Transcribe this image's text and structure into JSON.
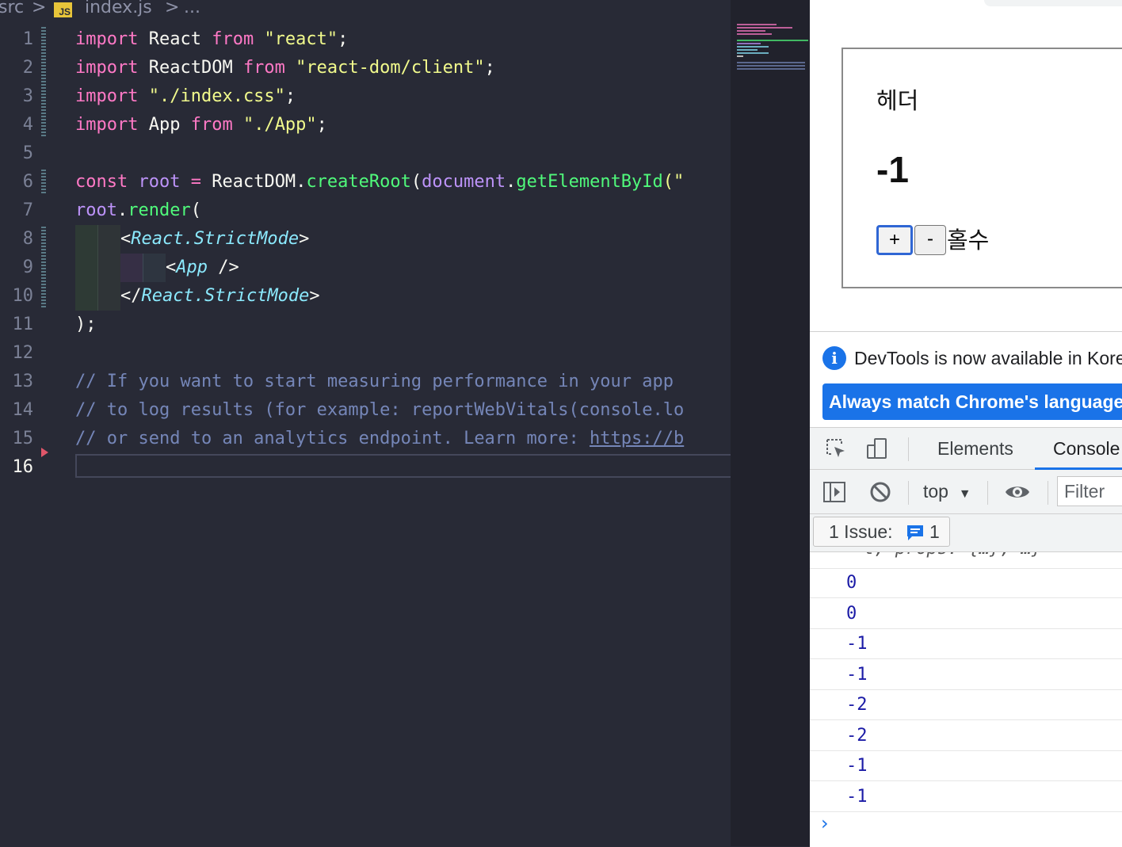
{
  "breadcrumb": {
    "folder": "src",
    "sep1": ">",
    "file_badge": "JS",
    "file": "index.js",
    "sep2": ">",
    "more": "..."
  },
  "editor": {
    "line_numbers": [
      "1",
      "2",
      "3",
      "4",
      "5",
      "6",
      "7",
      "8",
      "9",
      "10",
      "11",
      "12",
      "13",
      "14",
      "15",
      "16"
    ],
    "current_line": "16",
    "code": {
      "l1": {
        "kw1": "import",
        "id": " React ",
        "kw2": "from",
        "sp": " ",
        "str": "\"react\"",
        "end": ";"
      },
      "l2": {
        "kw1": "import",
        "id": " ReactDOM ",
        "kw2": "from",
        "sp": " ",
        "str": "\"react-dom/client\"",
        "end": ";"
      },
      "l3": {
        "kw1": "import",
        "sp": " ",
        "str": "\"./index.css\"",
        "end": ";"
      },
      "l4": {
        "kw1": "import",
        "id": " App ",
        "kw2": "from",
        "sp": " ",
        "str": "\"./App\"",
        "end": ";"
      },
      "l6": {
        "kw": "const",
        "sp1": " ",
        "var": "root",
        "op": " = ",
        "obj": "ReactDOM",
        "dot": ".",
        "fn": "createRoot",
        "p": "(",
        "var2": "document",
        "dot2": ".",
        "fn2": "getElementById",
        "p2": "(\""
      },
      "l7": {
        "var": "root",
        "dot": ".",
        "fn": "render",
        "p": "("
      },
      "l8": {
        "lt": "<",
        "tag": "React.StrictMode",
        "gt": ">"
      },
      "l9": {
        "lt": "<",
        "tag": "App",
        "gt": " />"
      },
      "l10": {
        "lt": "</",
        "tag": "React.StrictMode",
        "gt": ">"
      },
      "l11": {
        "text": ");"
      },
      "l13": {
        "text": "// If you want to start measuring performance in your app"
      },
      "l14": {
        "text": "// to log results (for example: reportWebVitals(console.lo"
      },
      "l15": {
        "pre": "// or send to an analytics endpoint. Learn more: ",
        "link": "https://b"
      }
    }
  },
  "app": {
    "header": "헤더",
    "count": "-1",
    "plus_label": "+",
    "minus_label": "-",
    "parity": "홀수"
  },
  "devtools": {
    "notice_text": "DevTools is now available in Korean",
    "info_icon": "i",
    "match_button": "Always match Chrome's language",
    "tabs": {
      "elements": "Elements",
      "console": "Console"
    },
    "context": "top",
    "context_arrow": "▼",
    "filter_placeholder": "Filter",
    "issues_label": "1 Issue:",
    "issues_count": "1",
    "console_cut_text": "t, props: {…}, …}",
    "console_rows": [
      "0",
      "0",
      "-1",
      "-1",
      "-2",
      "-2",
      "-1",
      "-1"
    ],
    "prompt": "›"
  },
  "colors": {
    "editor_bg": "#282a36",
    "keyword": "#ff79c6",
    "string": "#f1fa8c",
    "variable": "#bd93f9",
    "function": "#50fa7b",
    "tag": "#8be9fd",
    "comment": "#7586b8",
    "devtools_accent": "#1a73e8",
    "console_value": "#1a1aa6"
  },
  "icons": [
    "js-file-icon",
    "inspect-element-icon",
    "device-toolbar-icon",
    "sidebar-toggle-icon",
    "clear-console-icon",
    "eye-icon",
    "issue-chat-icon",
    "info-icon",
    "chevron-right-icon"
  ]
}
